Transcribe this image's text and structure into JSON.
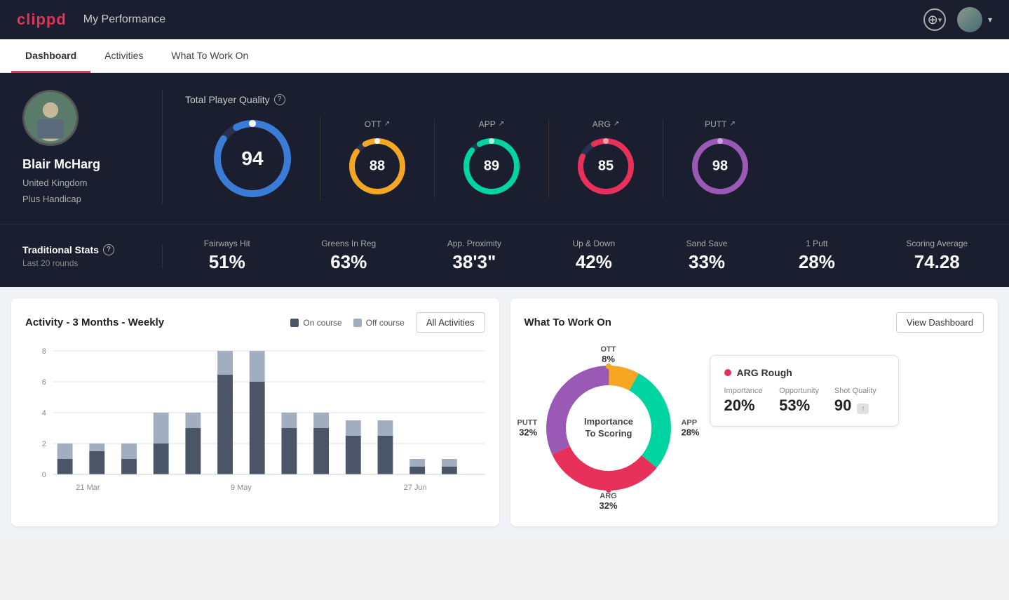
{
  "header": {
    "logo": "clippd",
    "title": "My Performance",
    "add_icon": "+",
    "chevron": "▾"
  },
  "tabs": [
    {
      "id": "dashboard",
      "label": "Dashboard",
      "active": true
    },
    {
      "id": "activities",
      "label": "Activities",
      "active": false
    },
    {
      "id": "what-to-work-on",
      "label": "What To Work On",
      "active": false
    }
  ],
  "hero": {
    "player": {
      "name": "Blair McHarg",
      "country": "United Kingdom",
      "handicap": "Plus Handicap"
    },
    "total_quality": {
      "label": "Total Player Quality",
      "value": 94,
      "color": "#3a7bd5"
    },
    "metrics": [
      {
        "label": "OTT",
        "value": 88,
        "color": "#f5a623",
        "arrow": "↗"
      },
      {
        "label": "APP",
        "value": 89,
        "color": "#00d4a0",
        "arrow": "↗"
      },
      {
        "label": "ARG",
        "value": 85,
        "color": "#e8315a",
        "arrow": "↗"
      },
      {
        "label": "PUTT",
        "value": 98,
        "color": "#9b59b6",
        "arrow": "↗"
      }
    ]
  },
  "trad_stats": {
    "title": "Traditional Stats",
    "subtitle": "Last 20 rounds",
    "items": [
      {
        "label": "Fairways Hit",
        "value": "51%"
      },
      {
        "label": "Greens In Reg",
        "value": "63%"
      },
      {
        "label": "App. Proximity",
        "value": "38'3\""
      },
      {
        "label": "Up & Down",
        "value": "42%"
      },
      {
        "label": "Sand Save",
        "value": "33%"
      },
      {
        "label": "1 Putt",
        "value": "28%"
      },
      {
        "label": "Scoring Average",
        "value": "74.28"
      }
    ]
  },
  "activity_chart": {
    "title": "Activity - 3 Months - Weekly",
    "legend": [
      {
        "label": "On course",
        "color": "#4a5568"
      },
      {
        "label": "Off course",
        "color": "#a0aec0"
      }
    ],
    "all_activities_btn": "All Activities",
    "x_labels": [
      "21 Mar",
      "9 May",
      "27 Jun"
    ],
    "y_labels": [
      "0",
      "2",
      "4",
      "6",
      "8"
    ],
    "bars": [
      {
        "on": 1,
        "off": 1
      },
      {
        "on": 1.5,
        "off": 0.5
      },
      {
        "on": 1,
        "off": 1
      },
      {
        "on": 2,
        "off": 2
      },
      {
        "on": 3,
        "off": 1
      },
      {
        "on": 7,
        "off": 2
      },
      {
        "on": 6,
        "off": 2
      },
      {
        "on": 3,
        "off": 1
      },
      {
        "on": 3,
        "off": 1
      },
      {
        "on": 2.5,
        "off": 1
      },
      {
        "on": 2.5,
        "off": 1
      },
      {
        "on": 0.5,
        "off": 0.5
      },
      {
        "on": 0.5,
        "off": 0.5
      }
    ]
  },
  "what_to_work_on": {
    "title": "What To Work On",
    "view_dashboard_btn": "View Dashboard",
    "donut": {
      "center_line1": "Importance",
      "center_line2": "To Scoring",
      "segments": [
        {
          "label": "OTT",
          "pct": "8%",
          "color": "#f5a623"
        },
        {
          "label": "APP",
          "pct": "28%",
          "color": "#00d4a0"
        },
        {
          "label": "ARG",
          "pct": "32%",
          "color": "#e8315a"
        },
        {
          "label": "PUTT",
          "pct": "32%",
          "color": "#9b59b6"
        }
      ]
    },
    "card": {
      "title": "ARG Rough",
      "dot_color": "#e8315a",
      "metrics": [
        {
          "label": "Importance",
          "value": "20%"
        },
        {
          "label": "Opportunity",
          "value": "53%"
        },
        {
          "label": "Shot Quality",
          "value": "90",
          "badge": ""
        }
      ]
    }
  }
}
